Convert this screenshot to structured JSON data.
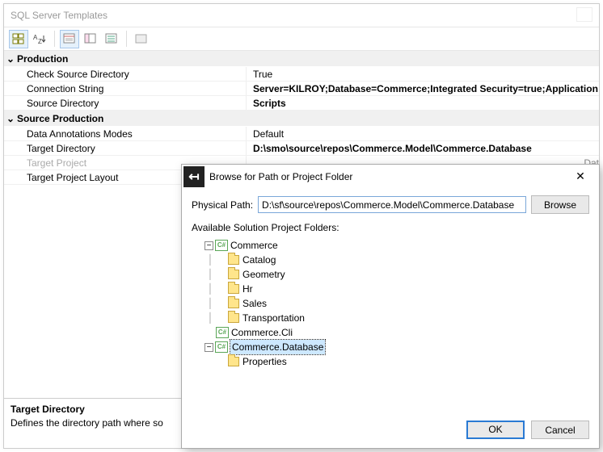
{
  "window": {
    "title": "SQL Server Templates"
  },
  "propgrid": {
    "categories": [
      {
        "name": "Production",
        "rows": [
          {
            "label": "Check Source Directory",
            "value": "True"
          },
          {
            "label": "Connection String",
            "value": "Server=KILROY;Database=Commerce;Integrated Security=true;Application",
            "bold": true
          },
          {
            "label": "Source Directory",
            "value": "Scripts",
            "bold": true
          }
        ]
      },
      {
        "name": "Source Production",
        "rows": [
          {
            "label": "Data Annotations Modes",
            "value": "Default"
          },
          {
            "label": "Target Directory",
            "value": "D:\\smo\\source\\repos\\Commerce.Model\\Commerce.Database",
            "bold": true
          },
          {
            "label": "Target Project",
            "value": "",
            "greyed": true,
            "truncated": "Dat"
          },
          {
            "label": "Target Project Layout",
            "value": ""
          }
        ]
      }
    ]
  },
  "description": {
    "heading": "Target Directory",
    "body": "Defines the directory path where so"
  },
  "dialog": {
    "title": "Browse for Path or Project Folder",
    "physical_path_label": "Physical Path:",
    "physical_path_value": "D:\\sf\\source\\repos\\Commerce.Model\\Commerce.Database",
    "browse_label": "Browse",
    "available_label": "Available Solution Project Folders:",
    "ok_label": "OK",
    "cancel_label": "Cancel",
    "tree": {
      "commerce": "Commerce",
      "catalog": "Catalog",
      "geometry": "Geometry",
      "hr": "Hr",
      "sales": "Sales",
      "transportation": "Transportation",
      "cli": "Commerce.Cli",
      "db": "Commerce.Database",
      "properties": "Properties"
    }
  }
}
